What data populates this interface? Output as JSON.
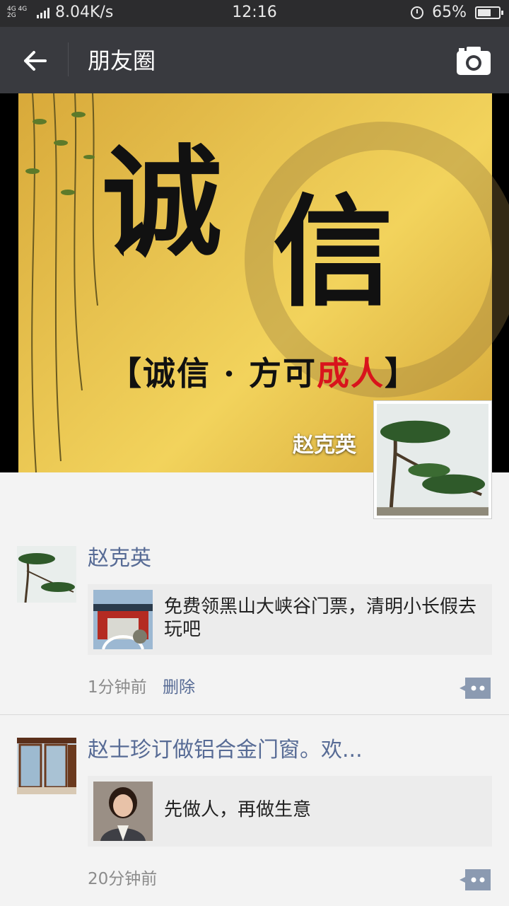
{
  "status_bar": {
    "network_type_top": "4G 4G",
    "network_type_bottom": "2G",
    "speed": "8.04K/s",
    "time": "12:16",
    "battery": "65%",
    "battery_level": 0.65
  },
  "nav": {
    "title": "朋友圈",
    "back_icon": "back-arrow-icon",
    "camera_icon": "camera-icon"
  },
  "cover": {
    "char1": "诚",
    "char2": "信",
    "slogan_open": "【",
    "slogan_main": "诚信 · 方可",
    "slogan_red": "成人",
    "slogan_close": "】",
    "user_name": "赵克英"
  },
  "posts": [
    {
      "author": "赵克英",
      "link_title": "免费领黑山大峡谷门票，清明小长假去玩吧",
      "time": "1分钟前",
      "delete_label": "删除"
    },
    {
      "author": "赵士珍订做铝合金门窗。欢...",
      "link_title": "先做人，再做生意",
      "time": "20分钟前"
    }
  ],
  "colors": {
    "nav_bg": "#393a3f",
    "status_bg": "#2c2c2e",
    "link_blue": "#576b95",
    "page_bg": "#f3f3f3"
  }
}
